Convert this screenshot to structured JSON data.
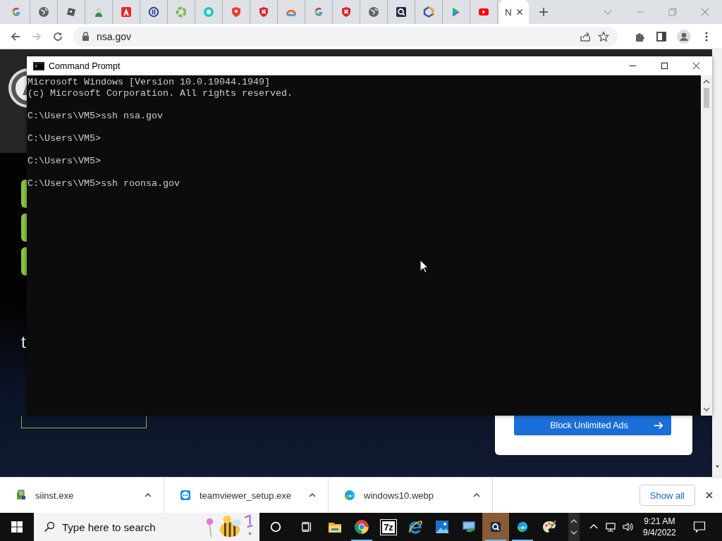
{
  "browser": {
    "tabs": [
      {
        "kind": "google",
        "selected": false
      },
      {
        "kind": "globe",
        "selected": false
      },
      {
        "kind": "box",
        "selected": false
      },
      {
        "kind": "person",
        "selected": false
      },
      {
        "kind": "adobe",
        "selected": false
      },
      {
        "kind": "bars-circle",
        "selected": false
      },
      {
        "kind": "green-ring",
        "selected": false
      },
      {
        "kind": "teal-ring",
        "selected": false
      },
      {
        "kind": "shield",
        "selected": false
      },
      {
        "kind": "shield-x",
        "selected": false
      },
      {
        "kind": "rainbow",
        "selected": false
      },
      {
        "kind": "google",
        "selected": false
      },
      {
        "kind": "shield-x",
        "selected": false
      },
      {
        "kind": "globe",
        "selected": false
      },
      {
        "kind": "q-square",
        "selected": false
      },
      {
        "kind": "hexagon",
        "selected": false
      },
      {
        "kind": "play",
        "selected": false
      },
      {
        "kind": "youtube",
        "selected": false
      },
      {
        "kind": "page",
        "title": "N",
        "selected": true
      }
    ],
    "address": "nsa.gov"
  },
  "page": {
    "text_fragments": [
      "t"
    ],
    "ad_button": "Block Unlimited Ads"
  },
  "terminal": {
    "title": "Command Prompt",
    "blocks": [
      [
        "Microsoft Windows [Version 10.0.19044.1949]",
        "(c) Microsoft Corporation. All rights reserved."
      ],
      [
        "C:\\Users\\VM5>ssh nsa.gov"
      ],
      [
        "C:\\Users\\VM5>"
      ],
      [
        "C:\\Users\\VM5>"
      ],
      [
        "C:\\Users\\VM5>ssh roonsa.gov"
      ]
    ]
  },
  "downloads": {
    "items": [
      {
        "kind": "installer",
        "name": "siinst.exe"
      },
      {
        "kind": "teamviewer",
        "name": "teamviewer_setup.exe"
      },
      {
        "kind": "edge",
        "name": "windows10.webp"
      }
    ],
    "show_all": "Show all"
  },
  "taskbar": {
    "search": {
      "placeholder": "Type here to search"
    },
    "apps": [
      {
        "kind": "explorer",
        "active": false,
        "running": false
      },
      {
        "kind": "chrome",
        "active": false,
        "running": true
      },
      {
        "kind": "archive",
        "label": "7z",
        "active": false,
        "running": false
      },
      {
        "kind": "ie",
        "active": false,
        "running": false
      },
      {
        "kind": "photos",
        "active": false,
        "running": false
      },
      {
        "kind": "remote",
        "active": false,
        "running": false
      },
      {
        "kind": "q-square",
        "active": true,
        "running": true
      },
      {
        "kind": "edge",
        "active": false,
        "running": true
      },
      {
        "kind": "paint",
        "active": false,
        "running": false
      }
    ],
    "time": "9:21 AM",
    "date": "9/4/2022"
  }
}
